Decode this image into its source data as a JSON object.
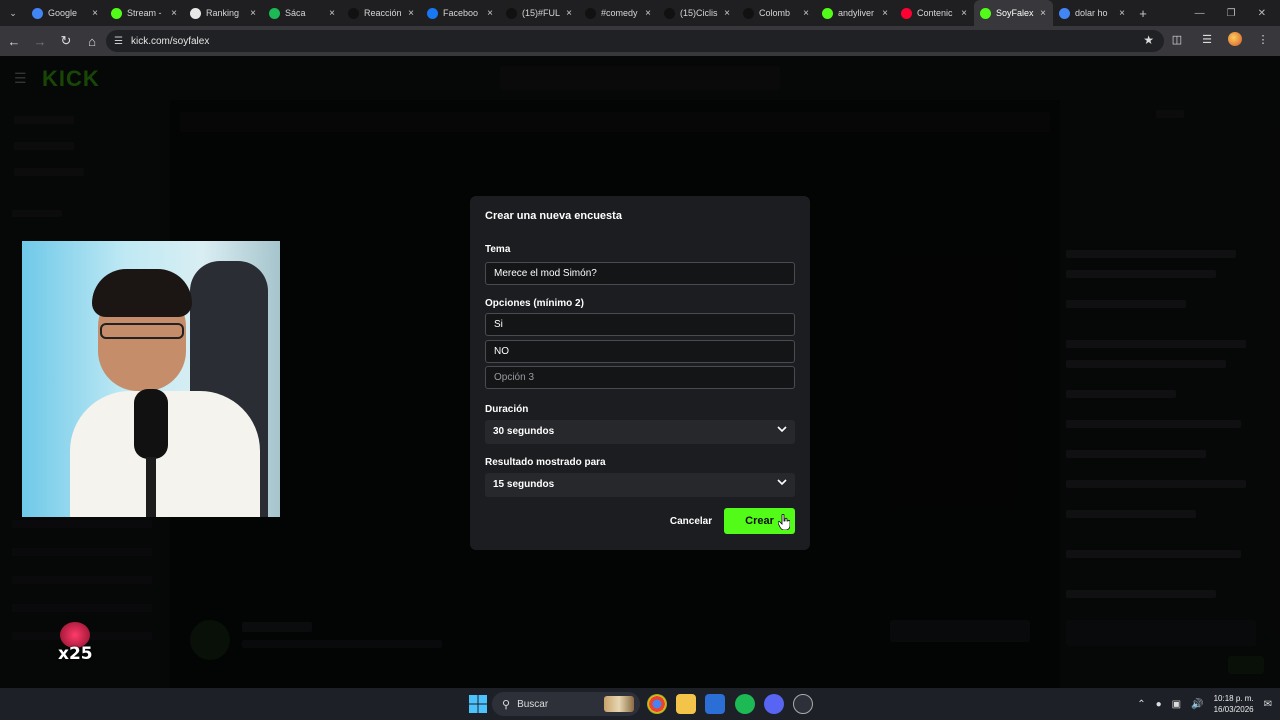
{
  "browser": {
    "tabs": [
      {
        "title": "Google",
        "fav": "google-icon",
        "color": "#4285f4"
      },
      {
        "title": "Stream -",
        "fav": "kick-icon",
        "color": "#53fc18"
      },
      {
        "title": "Ranking",
        "fav": "diamond-icon",
        "color": "#e8e8e8"
      },
      {
        "title": "Sáca",
        "fav": "spotify-icon",
        "color": "#1db954"
      },
      {
        "title": "Reacción",
        "fav": "tiktok-icon",
        "color": "#111111"
      },
      {
        "title": "Faceboo",
        "fav": "facebook-icon",
        "color": "#1877f2"
      },
      {
        "title": "(15)#FUL",
        "fav": "tiktok-icon",
        "color": "#111111"
      },
      {
        "title": "#comedy",
        "fav": "tiktok-icon",
        "color": "#111111"
      },
      {
        "title": "(15)Ciclis",
        "fav": "tiktok-icon",
        "color": "#111111"
      },
      {
        "title": "Colomb",
        "fav": "tiktok-icon",
        "color": "#111111"
      },
      {
        "title": "andyliver",
        "fav": "kick-icon",
        "color": "#53fc18"
      },
      {
        "title": "Contenic",
        "fav": "youtube-icon",
        "color": "#ff0033"
      },
      {
        "title": "SoyFalex",
        "fav": "kick-icon",
        "color": "#53fc18"
      },
      {
        "title": "dolar ho",
        "fav": "google-icon",
        "color": "#4285f4"
      }
    ],
    "active_tab_index": 12,
    "url": "kick.com/soyfalex"
  },
  "modal": {
    "title": "Crear una nueva encuesta",
    "topic_label": "Tema",
    "topic_value": "Merece el mod Simón?",
    "options_label": "Opciones (mínimo 2)",
    "option1_value": "Si",
    "option2_value": "NO",
    "option3_placeholder": "Opción 3",
    "duration_label": "Duración",
    "duration_value": "30 segundos",
    "result_label": "Resultado mostrado para",
    "result_value": "15 segundos",
    "cancel_label": "Cancelar",
    "create_label": "Crear",
    "accent": "#53fc18"
  },
  "overlay": {
    "badge_text": "x25"
  },
  "taskbar": {
    "search_label": "Buscar",
    "time": "10:18 p. m.",
    "date": "16/03/2026"
  }
}
